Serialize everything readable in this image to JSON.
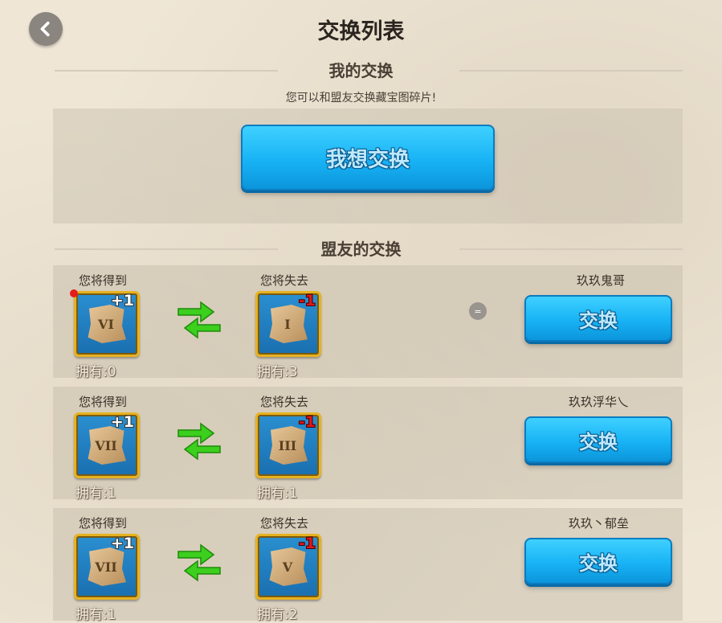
{
  "header": {
    "title": "交换列表"
  },
  "my_exchange": {
    "heading": "我的交换",
    "subtitle": "您可以和盟友交换藏宝图碎片!",
    "want_button": "我想交换"
  },
  "ally_exchange": {
    "heading": "盟友的交换",
    "rows": [
      {
        "get_label": "您将得到",
        "lose_label": "您将失去",
        "get_piece": "VI",
        "get_delta": "+1",
        "get_owned": "拥有:0",
        "lose_piece": "I",
        "lose_delta": "-1",
        "lose_owned": "拥有:3",
        "player": "玖玖鬼哥",
        "button": "交换"
      },
      {
        "get_label": "您将得到",
        "lose_label": "您将失去",
        "get_piece": "VII",
        "get_delta": "+1",
        "get_owned": "拥有:1",
        "lose_piece": "III",
        "lose_delta": "-1",
        "lose_owned": "拥有:1",
        "player": "玖玖浮华乀",
        "button": "交换"
      },
      {
        "get_label": "您将得到",
        "lose_label": "您将失去",
        "get_piece": "VII",
        "get_delta": "+1",
        "get_owned": "拥有:1",
        "lose_piece": "V",
        "lose_delta": "-1",
        "lose_owned": "拥有:2",
        "player": "玖玖丶郁垒",
        "button": "交换"
      }
    ]
  },
  "misc": {
    "eq_symbol": "="
  },
  "colors": {
    "button_blue": "#18b3f5",
    "card_border": "#e7b21f",
    "arrow_green": "#3ccf1e",
    "minus_red": "#e01818"
  }
}
